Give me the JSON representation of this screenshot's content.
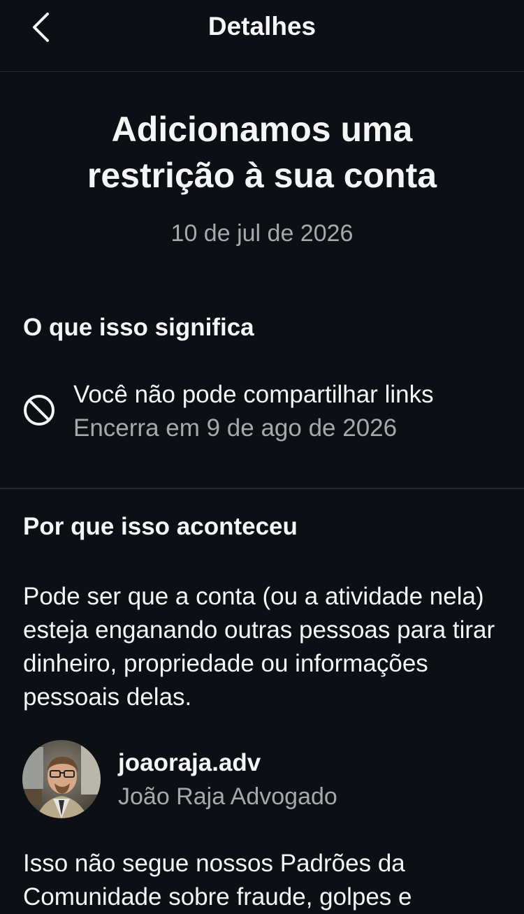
{
  "header": {
    "title": "Detalhes",
    "back_icon": "chevron-left-icon"
  },
  "main": {
    "title": "Adicionamos uma restrição à sua conta",
    "date": "10 de jul de 2026"
  },
  "meaning": {
    "heading": "O que isso significa",
    "icon": "prohibited-icon",
    "restriction_title": "Você não pode compartilhar links",
    "restriction_ends": "Encerra em 9 de ago de 2026"
  },
  "reason": {
    "heading": "Por que isso aconteceu",
    "text": "Pode ser que a conta (ou a atividade nela) esteja enganando outras pessoas para tirar dinheiro, propriedade ou informações pessoais delas."
  },
  "account": {
    "username": "joaoraja.adv",
    "full_name": "João Raja Advogado"
  },
  "footer_text": "Isso não segue nossos Padrões da Comunidade sobre fraude, golpes e",
  "colors": {
    "background": "#0c1014",
    "primary_text": "#f5f5f5",
    "secondary_text": "#a8a8a8",
    "divider": "#262a2f"
  }
}
